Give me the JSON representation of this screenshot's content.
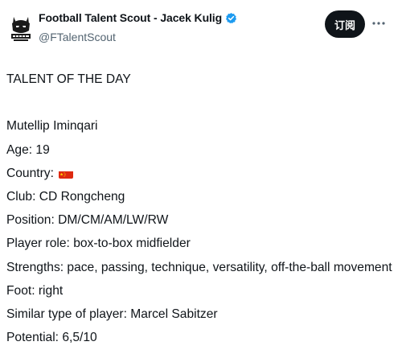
{
  "author": {
    "display_name": "Football Talent Scout - Jacek Kulig",
    "handle": "@FTalentScout",
    "avatar_icon": "scout-logo-icon",
    "verified_icon": "verified-badge-icon"
  },
  "actions": {
    "subscribe_label": "订阅",
    "more_icon": "more-options-icon"
  },
  "tweet": {
    "heading": "TALENT OF THE DAY",
    "player_name": "Mutellip Iminqari",
    "age": "Age: 19",
    "country_label": "Country:",
    "country_flag_icon": "china-flag-icon",
    "club": "Club: CD Rongcheng",
    "position": "Position: DM/CM/AM/LW/RW",
    "player_role": "Player role: box-to-box midfielder",
    "strengths": "Strengths: pace, passing, technique, versatility, off-the-ball movement",
    "foot": "Foot: right",
    "similar_player": "Similar type of player: Marcel Sabitzer",
    "potential": "Potential: 6,5/10"
  },
  "colors": {
    "text_primary": "#0f1419",
    "text_secondary": "#536471",
    "verified_blue": "#1d9bf0",
    "button_bg": "#0f1419",
    "flag_red": "#de2910",
    "flag_yellow": "#ffde00"
  }
}
